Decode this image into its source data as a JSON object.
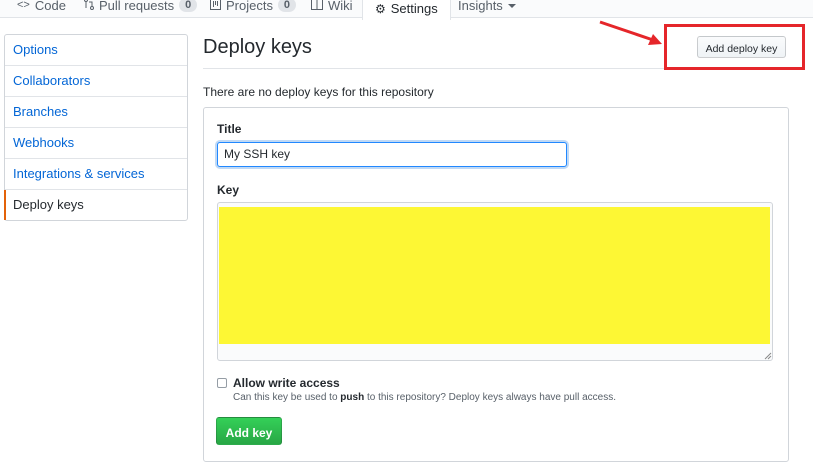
{
  "repo_nav": {
    "tabs": [
      {
        "icon": "code-icon",
        "label": "Code"
      },
      {
        "icon": "pull-request-icon",
        "label": "Pull requests",
        "count": "0"
      },
      {
        "icon": "project-icon",
        "label": "Projects",
        "count": "0"
      },
      {
        "icon": "wiki-icon",
        "label": "Wiki"
      },
      {
        "icon": "gear-icon",
        "label": "Settings",
        "selected": true
      },
      {
        "label": "Insights",
        "icon": "caret-down-icon"
      }
    ]
  },
  "sidebar": {
    "items": [
      {
        "label": "Options"
      },
      {
        "label": "Collaborators"
      },
      {
        "label": "Branches"
      },
      {
        "label": "Webhooks"
      },
      {
        "label": "Integrations & services"
      },
      {
        "label": "Deploy keys",
        "selected": true
      }
    ]
  },
  "main": {
    "title": "Deploy keys",
    "add_deploy_key_label": "Add deploy key",
    "empty_message": "There are no deploy keys for this repository",
    "form": {
      "title_label": "Title",
      "title_value": "My SSH key",
      "key_label": "Key",
      "key_value": "",
      "allow_write_label": "Allow write access",
      "allow_write_note_prefix": "Can this key be used to ",
      "allow_write_note_bold": "push",
      "allow_write_note_suffix": " to this repository? Deploy keys always have pull access.",
      "allow_write_checked": false,
      "submit_label": "Add key"
    }
  },
  "colors": {
    "annotation_red": "#e5262a",
    "key_highlight": "#fdf734",
    "accent_orange": "#e36209",
    "primary_green": "#28a745",
    "link_blue": "#0366d6"
  }
}
